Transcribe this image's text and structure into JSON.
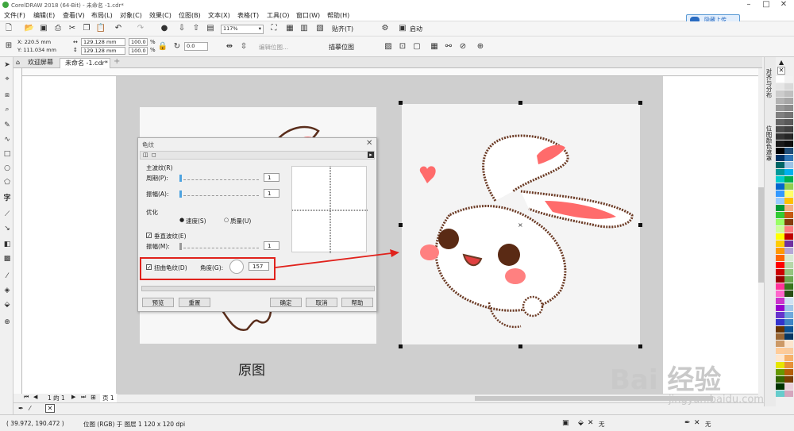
{
  "app": {
    "title": "CorelDRAW 2018 (64-Bit) - 未命名 -1.cdr*",
    "upload_label": "隐藏上传"
  },
  "menu": [
    "文件(F)",
    "编辑(E)",
    "查看(V)",
    "布局(L)",
    "对象(C)",
    "效果(C)",
    "位图(B)",
    "文本(X)",
    "表格(T)",
    "工具(O)",
    "窗口(W)",
    "帮助(H)"
  ],
  "toolbar": {
    "zoom": "117%",
    "snap": "贴齐(T)",
    "launch": "启动"
  },
  "props": {
    "x": "X: 220.5 mm",
    "y": "Y: 111.034 mm",
    "w": "129.128 mm",
    "h": "129.128 mm",
    "sw": "100.0",
    "sh": "100.0",
    "pct": "%",
    "rot": "0.0",
    "edit_bitmap": "编辑位图...",
    "trace_bitmap": "描摹位图"
  },
  "tabs": [
    "欢迎屏幕",
    "未命名 -1.cdr*"
  ],
  "canvas": {
    "orig_label": "原图"
  },
  "dialog": {
    "title": "龟纹",
    "main_group": "主波纹(R)",
    "period_label": "周期(P):",
    "period_value": "1",
    "amplitude_label": "振幅(A):",
    "amplitude_value": "1",
    "optimize_group": "优化",
    "speed_label": "速度(S)",
    "quality_label": "质量(U)",
    "vertical_label": "垂直波纹(E)",
    "v_amplitude_label": "振幅(M):",
    "v_amplitude_value": "1",
    "distort_label": "扭曲龟纹(D)",
    "angle_label": "角度(G):",
    "angle_value": "157",
    "btn_preview": "预览",
    "btn_reset": "重置",
    "btn_ok": "确定",
    "btn_cancel": "取消",
    "btn_help": "帮助"
  },
  "docker": {
    "tab1": "对齐与分布",
    "tab2": "位图颜色遮罩"
  },
  "bottom": {
    "page_of": "1 的 1",
    "page_tab": "页 1"
  },
  "status": {
    "coords": "( 39.972, 190.472 )",
    "info": "位图 (RGB) 于 图层 1 120 x 120 dpi",
    "fill_none": "无",
    "outline_none": "无"
  },
  "watermark": {
    "brand": "Bai 经验",
    "url": "jingyan.baidu.com"
  },
  "palette": [
    "#ffffff",
    "#e6e6e6",
    "#cccccc",
    "#b3b3b3",
    "#999999",
    "#808080",
    "#666666",
    "#4d4d4d",
    "#333333",
    "#1a1a1a",
    "#000000",
    "#003366",
    "#006666",
    "#009999",
    "#00cccc",
    "#0066cc",
    "#3399ff",
    "#99ccff",
    "#009933",
    "#33cc33",
    "#99ff66",
    "#ccff99",
    "#ffff00",
    "#ffcc00",
    "#ff9900",
    "#ff6600",
    "#ff0000",
    "#cc0000",
    "#990000",
    "#ff3399",
    "#ff66cc",
    "#cc33cc",
    "#9900cc",
    "#6633cc",
    "#3333cc",
    "#663300",
    "#996633",
    "#cc9966",
    "#ffcc99",
    "#ffe6cc",
    "#e6e600",
    "#669900",
    "#336600",
    "#003300",
    "#66cccc"
  ],
  "palette2": [
    "#f2f2f2",
    "#d9d9d9",
    "#bfbfbf",
    "#a6a6a6",
    "#8c8c8c",
    "#737373",
    "#595959",
    "#404040",
    "#262626",
    "#0d0d0d",
    "#1f4e79",
    "#2e75b6",
    "#9dc3e6",
    "#00b0f0",
    "#00b050",
    "#92d050",
    "#ffff66",
    "#ffc000",
    "#f4b183",
    "#c55a11",
    "#843c0c",
    "#ff7c80",
    "#c00000",
    "#7030a0",
    "#b4a7d6",
    "#d9ead3",
    "#b6d7a8",
    "#93c47d",
    "#6aa84f",
    "#38761d",
    "#274e13",
    "#cfe2f3",
    "#9fc5e8",
    "#6fa8dc",
    "#3d85c6",
    "#0b5394",
    "#073763",
    "#fce5cd",
    "#f9cb9c",
    "#f6b26b",
    "#e69138",
    "#b45f06",
    "#783f04",
    "#ead1dc",
    "#d5a6bd"
  ]
}
